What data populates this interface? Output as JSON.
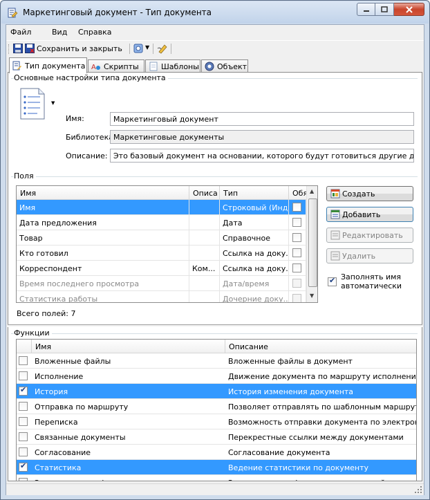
{
  "window": {
    "title": "Маркетинговый документ - Тип документа"
  },
  "menu": [
    "Файл",
    "Вид",
    "Справка"
  ],
  "toolbar": {
    "save_close_label": "Сохранить и закрыть"
  },
  "tabs": [
    {
      "label": "Тип документа",
      "icon": "document-type-icon",
      "active": true
    },
    {
      "label": "Скрипты",
      "icon": "scripts-icon",
      "active": false
    },
    {
      "label": "Шаблоны",
      "icon": "templates-icon",
      "active": false
    },
    {
      "label": "Объект",
      "icon": "object-icon",
      "active": false
    }
  ],
  "basic_settings": {
    "group_title": "Основные настройки типа документа",
    "name_label": "Имя:",
    "name_value": "Маркетинговый документ",
    "library_label": "Библиотека:",
    "library_value": "Маркетинговые документы",
    "description_label": "Описание:",
    "description_value": "Это базовый документ на основании, которого будут готовиться другие документы"
  },
  "fields": {
    "group_title": "Поля",
    "columns": [
      "Имя",
      "Описа",
      "Тип",
      "Обя"
    ],
    "rows": [
      {
        "name": "Имя",
        "desc": "",
        "type": "Строковый (Инд...",
        "selected": true,
        "dim": false
      },
      {
        "name": "Дата предложения",
        "desc": "",
        "type": "Дата",
        "selected": false,
        "dim": false
      },
      {
        "name": "Товар",
        "desc": "",
        "type": "Справочное",
        "selected": false,
        "dim": false
      },
      {
        "name": "Кто готовил",
        "desc": "",
        "type": "Ссылка на доку...",
        "selected": false,
        "dim": false
      },
      {
        "name": "Корреспондент",
        "desc": "Ком...",
        "type": "Ссылка на доку...",
        "selected": false,
        "dim": false
      },
      {
        "name": "Время последнего просмотра",
        "desc": "",
        "type": "Дата/время",
        "selected": false,
        "dim": true
      },
      {
        "name": "Статистика работы",
        "desc": "",
        "type": "Дочерние доку...",
        "selected": false,
        "dim": true
      }
    ],
    "total": "Всего полей: 7",
    "buttons": {
      "create": "Создать",
      "add": "Добавить",
      "edit": "Редактировать",
      "delete": "Удалить"
    },
    "autofill_label": "Заполнять имя автоматически",
    "autofill_checked": true
  },
  "functions": {
    "group_title": "Функции",
    "columns": [
      "Имя",
      "Описание"
    ],
    "rows": [
      {
        "name": "Вложенные файлы",
        "desc": "Вложенные файлы в документ",
        "checked": false,
        "selected": false
      },
      {
        "name": "Исполнение",
        "desc": "Движение документа по маршруту исполнения",
        "checked": false,
        "selected": false
      },
      {
        "name": "История",
        "desc": "История изменения документа",
        "checked": true,
        "selected": true
      },
      {
        "name": "Отправка по маршруту",
        "desc": "Позволяет отправлять по шаблонным маршрутам",
        "checked": false,
        "selected": false
      },
      {
        "name": "Переписка",
        "desc": "Возможность отправки документа по электронной ...",
        "checked": false,
        "selected": false
      },
      {
        "name": "Связанные документы",
        "desc": "Перекрестные ссылки между документами",
        "checked": false,
        "selected": false
      },
      {
        "name": "Согласование",
        "desc": "Согласование документа",
        "checked": false,
        "selected": false
      },
      {
        "name": "Статистика",
        "desc": "Ведение статистики по документу",
        "checked": true,
        "selected": true
      },
      {
        "name": "Электронная цифровая подпись",
        "desc": "Электронная цифровая подпись полей документа",
        "checked": false,
        "selected": false
      }
    ]
  },
  "colors": {
    "selection": "#3399ff",
    "window_frame": "#cfdcec"
  }
}
